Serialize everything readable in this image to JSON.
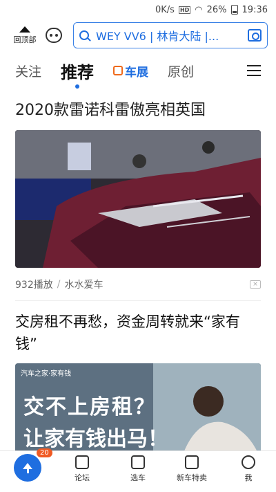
{
  "status_bar": {
    "speed": "0K/s",
    "hd": "HD",
    "battery": "26%",
    "time": "19:36"
  },
  "top_bar": {
    "back_to_top": "回顶部",
    "search_query": "WEY VV6 | 林肯大陆 |..."
  },
  "tabs": [
    {
      "label": "关注"
    },
    {
      "label": "推荐"
    },
    {
      "label": "车展"
    },
    {
      "label": "原创"
    }
  ],
  "feed": {
    "article1": {
      "title": "2020款雷诺科雷傲亮相英国",
      "plays": "932播放",
      "source": "水水爱车"
    },
    "article2": {
      "title": "交房租不再愁，资金周转就来“家有钱”",
      "ad_tag": "汽车之家·家有钱",
      "ad_line1": "交不上房租？",
      "ad_line2": "让家有钱出马！"
    }
  },
  "bottom_nav": {
    "badge": "20",
    "items": [
      {
        "label": "论坛"
      },
      {
        "label": "选车"
      },
      {
        "label": "新车特卖"
      },
      {
        "label": "我"
      }
    ]
  },
  "colors": {
    "accent": "#1f6ee0",
    "badge": "#f05a23",
    "expo_orange": "#ef6a1c"
  }
}
